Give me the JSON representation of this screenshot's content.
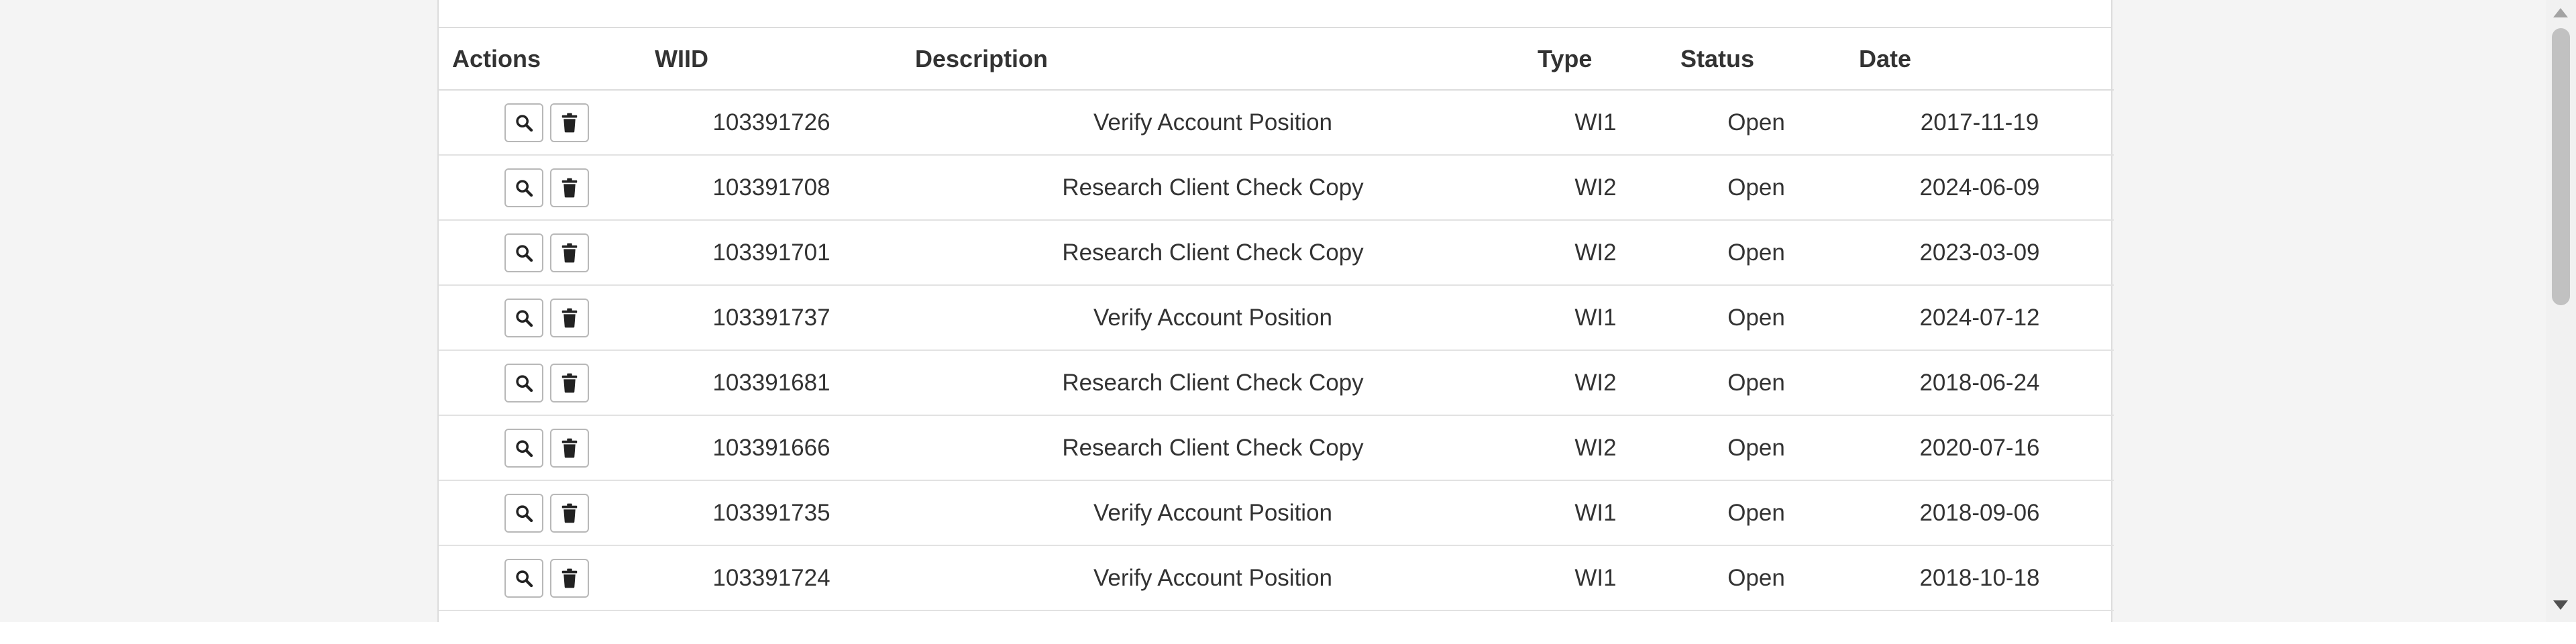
{
  "table": {
    "columns": [
      "Actions",
      "WIID",
      "Description",
      "Type",
      "Status",
      "Date"
    ],
    "rows": [
      {
        "wiid": "103391726",
        "description": "Verify Account Position",
        "type": "WI1",
        "status": "Open",
        "date": "2017-11-19"
      },
      {
        "wiid": "103391708",
        "description": "Research Client Check Copy",
        "type": "WI2",
        "status": "Open",
        "date": "2024-06-09"
      },
      {
        "wiid": "103391701",
        "description": "Research Client Check Copy",
        "type": "WI2",
        "status": "Open",
        "date": "2023-03-09"
      },
      {
        "wiid": "103391737",
        "description": "Verify Account Position",
        "type": "WI1",
        "status": "Open",
        "date": "2024-07-12"
      },
      {
        "wiid": "103391681",
        "description": "Research Client Check Copy",
        "type": "WI2",
        "status": "Open",
        "date": "2018-06-24"
      },
      {
        "wiid": "103391666",
        "description": "Research Client Check Copy",
        "type": "WI2",
        "status": "Open",
        "date": "2020-07-16"
      },
      {
        "wiid": "103391735",
        "description": "Verify Account Position",
        "type": "WI1",
        "status": "Open",
        "date": "2018-09-06"
      },
      {
        "wiid": "103391724",
        "description": "Verify Account Position",
        "type": "WI1",
        "status": "Open",
        "date": "2018-10-18"
      }
    ]
  },
  "icons": {
    "view": "search-icon",
    "delete": "trash-icon"
  },
  "colors": {
    "text": "#333333",
    "border": "#dcdcdc",
    "page_background": "#f4f4f4"
  }
}
